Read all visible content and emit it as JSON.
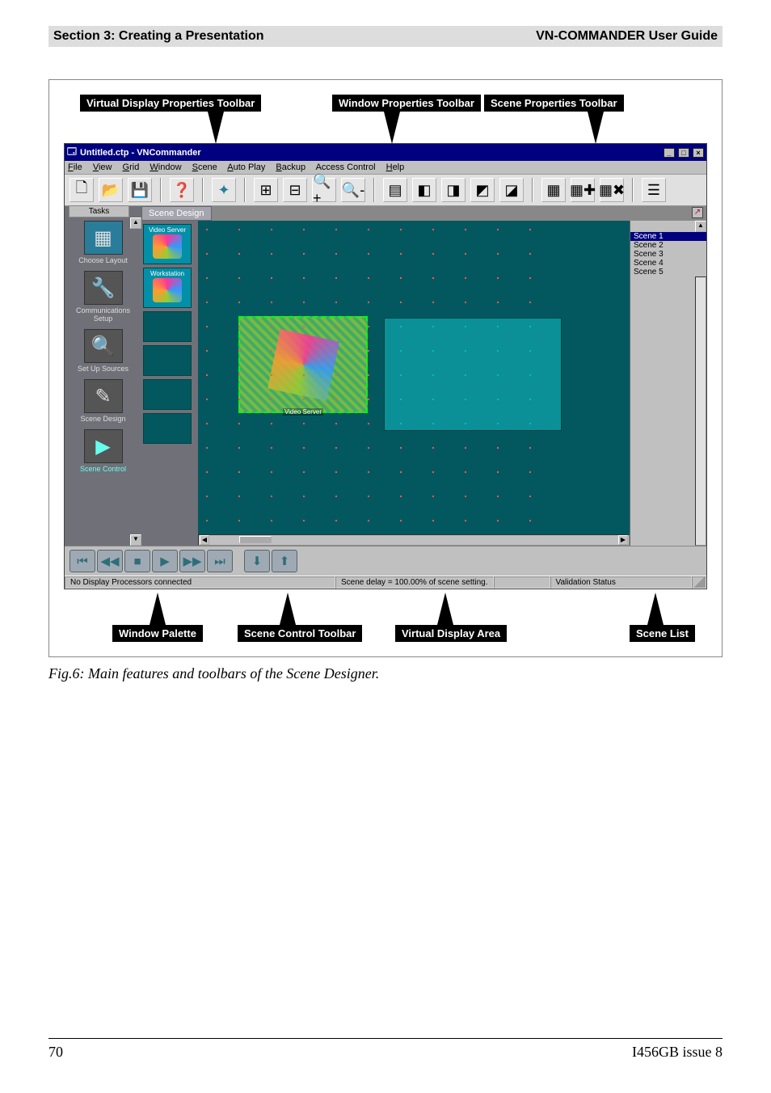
{
  "header": {
    "left": "Section 3: Creating a Presentation",
    "right": "VN-COMMANDER User Guide"
  },
  "labels": {
    "top": [
      "Virtual Display Properties Toolbar",
      "Window Properties Toolbar",
      "Scene Properties Toolbar"
    ],
    "bottom": [
      "Window Palette",
      "Scene Control Toolbar",
      "Virtual Display Area",
      "Scene List"
    ]
  },
  "app": {
    "title": "Untitled.ctp - VNCommander",
    "menus": [
      "File",
      "View",
      "Grid",
      "Window",
      "Scene",
      "Auto Play",
      "Backup",
      "Access Control",
      "Help"
    ],
    "tasks_tab": "Tasks",
    "scene_tab": "Scene Design",
    "tasks": [
      {
        "label": "Choose Layout"
      },
      {
        "label": "Communications Setup"
      },
      {
        "label": "Set Up Sources"
      },
      {
        "label": "Scene Design"
      },
      {
        "label": "Scene Control"
      }
    ],
    "palette": [
      {
        "label": "Video Server"
      },
      {
        "label": "Workstation"
      },
      {
        "label": ""
      },
      {
        "label": ""
      },
      {
        "label": ""
      },
      {
        "label": ""
      }
    ],
    "vs_window_label": "Video Server",
    "scenes": [
      "Scene 1",
      "Scene 2",
      "Scene 3",
      "Scene 4",
      "Scene 5"
    ],
    "status": {
      "s1": "No Display Processors connected",
      "s2": "Scene delay = 100.00% of scene setting.",
      "s3": "",
      "s4": "Validation Status"
    }
  },
  "caption": "Fig.6: Main features and toolbars of the Scene Designer.",
  "footer": {
    "page": "70",
    "issue": "I456GB issue 8"
  }
}
